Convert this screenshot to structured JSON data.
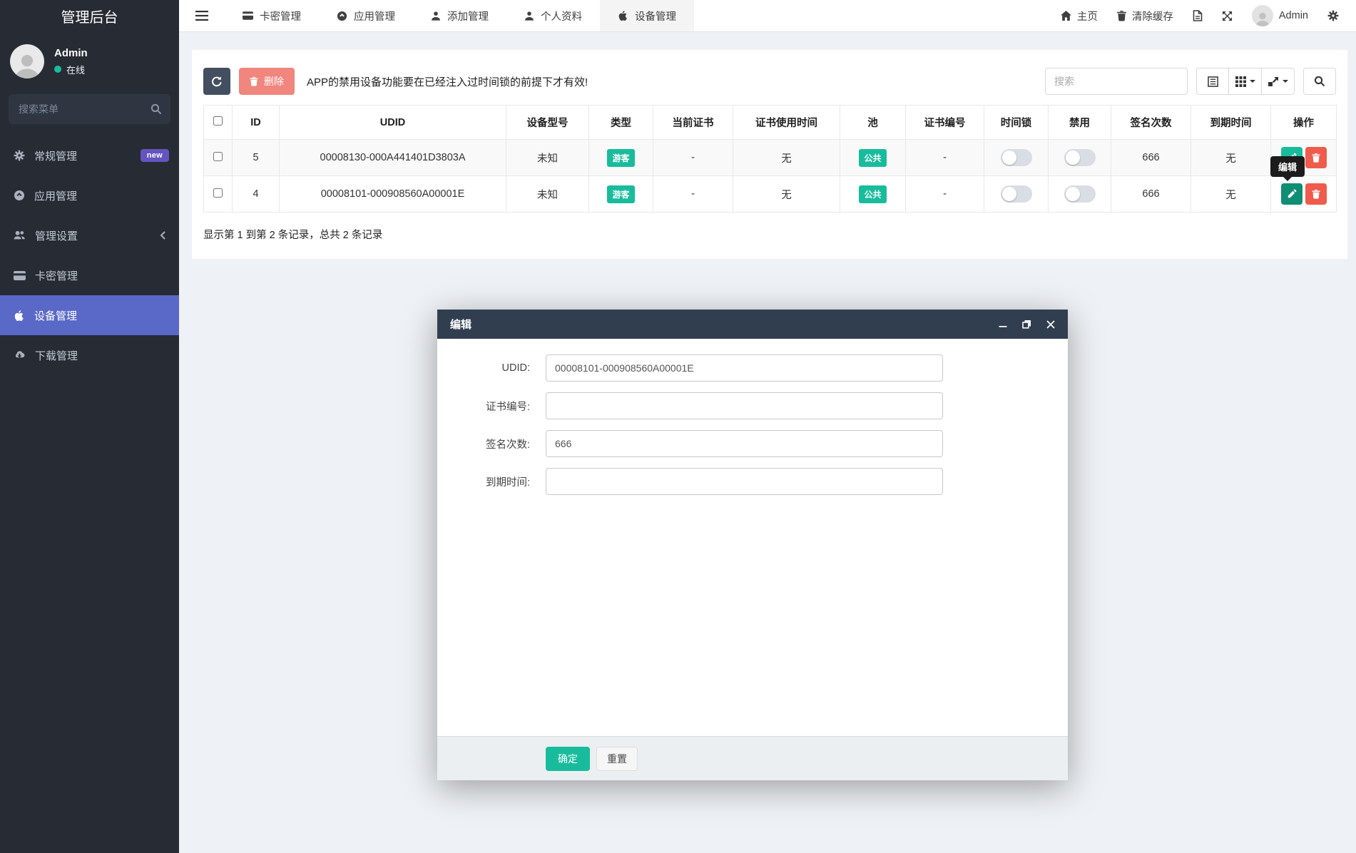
{
  "app": {
    "title": "管理后台"
  },
  "sidebar": {
    "user": {
      "name": "Admin",
      "status_label": "在线"
    },
    "search_placeholder": "搜索菜单",
    "items": [
      {
        "label": "常规管理",
        "icon": "gear-icon",
        "badge": "new"
      },
      {
        "label": "应用管理",
        "icon": "circle-arrow-icon"
      },
      {
        "label": "管理设置",
        "icon": "users-icon"
      },
      {
        "label": "卡密管理",
        "icon": "card-icon"
      },
      {
        "label": "设备管理",
        "icon": "apple-icon",
        "active": true
      },
      {
        "label": "下载管理",
        "icon": "cloud-download-icon"
      }
    ]
  },
  "navbar": {
    "tabs": [
      {
        "label": "卡密管理",
        "icon": "card-icon"
      },
      {
        "label": "应用管理",
        "icon": "circle-arrow-icon"
      },
      {
        "label": "添加管理",
        "icon": "user-icon"
      },
      {
        "label": "个人资料",
        "icon": "user-icon"
      },
      {
        "label": "设备管理",
        "icon": "apple-icon",
        "active": true
      }
    ],
    "home_label": "主页",
    "clear_cache_label": "清除缓存",
    "user_label": "Admin"
  },
  "toolbar": {
    "delete_label": "删除",
    "notice": "APP的禁用设备功能要在已经注入过时间锁的前提下才有效!",
    "search_placeholder": "搜索"
  },
  "table": {
    "columns": [
      "",
      "ID",
      "UDID",
      "设备型号",
      "类型",
      "当前证书",
      "证书使用时间",
      "池",
      "证书编号",
      "时间锁",
      "禁用",
      "签名次数",
      "到期时间",
      "操作"
    ],
    "rows": [
      {
        "id": "5",
        "udid": "00008130-000A441401D3803A",
        "model": "未知",
        "type": "游客",
        "cert": "-",
        "cert_time": "无",
        "pool": "公共",
        "cert_no": "-",
        "sign_count": "666",
        "expire": "无"
      },
      {
        "id": "4",
        "udid": "00008101-000908560A00001E",
        "model": "未知",
        "type": "游客",
        "cert": "-",
        "cert_time": "无",
        "pool": "公共",
        "cert_no": "-",
        "sign_count": "666",
        "expire": "无"
      }
    ],
    "summary": "显示第 1 到第 2 条记录，总共 2 条记录"
  },
  "tooltip": {
    "label": "编辑"
  },
  "modal": {
    "title": "编辑",
    "fields": [
      {
        "label": "UDID:",
        "value": "00008101-000908560A00001E"
      },
      {
        "label": "证书编号:",
        "value": ""
      },
      {
        "label": "签名次数:",
        "value": "666"
      },
      {
        "label": "到期时间:",
        "value": ""
      }
    ],
    "confirm_label": "确定",
    "reset_label": "重置"
  },
  "colors": {
    "accent_teal": "#18bc9c",
    "active_indigo": "#5a68c8",
    "badge_purple": "#6554c0",
    "danger_red": "#ef5b4c",
    "delete_soft_red": "#f0867d",
    "dark_slate": "#313e50",
    "sidebar_bg": "#272c34"
  }
}
